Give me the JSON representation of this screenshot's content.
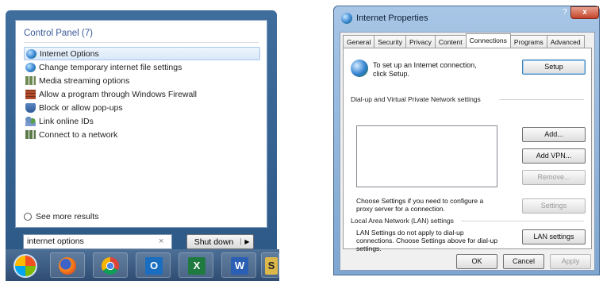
{
  "start_menu": {
    "heading": "Control Panel (7)",
    "items": [
      {
        "label": "Internet Options",
        "icon": "internet-options-icon",
        "selected": true
      },
      {
        "label": "Change temporary internet file settings",
        "icon": "internet-options-icon"
      },
      {
        "label": "Media streaming options",
        "icon": "network-icon"
      },
      {
        "label": "Allow a program through Windows Firewall",
        "icon": "firewall-icon"
      },
      {
        "label": "Block or allow pop-ups",
        "icon": "shield-icon"
      },
      {
        "label": "Link online IDs",
        "icon": "users-icon"
      },
      {
        "label": "Connect to a network",
        "icon": "network-icon"
      }
    ],
    "see_more": "See more results",
    "search_value": "internet options",
    "clear_glyph": "×",
    "shutdown_label": "Shut down",
    "shutdown_arrow": "▶"
  },
  "taskbar": {
    "items": [
      {
        "name": "start-orb-icon"
      },
      {
        "name": "firefox-icon"
      },
      {
        "name": "chrome-icon"
      },
      {
        "name": "outlook-icon",
        "glyph": "O"
      },
      {
        "name": "excel-icon",
        "glyph": "X"
      },
      {
        "name": "word-icon",
        "glyph": "W"
      },
      {
        "name": "sway-icon",
        "glyph": "S"
      }
    ]
  },
  "dialog": {
    "title": "Internet Properties",
    "help_glyph": "?",
    "close_glyph": "x",
    "tabs": [
      "General",
      "Security",
      "Privacy",
      "Content",
      "Connections",
      "Programs",
      "Advanced"
    ],
    "active_tab": "Connections",
    "setup_text": "To set up an Internet connection, click Setup.",
    "setup_button": "Setup",
    "dialup_group": "Dial-up and Virtual Private Network settings",
    "add_button": "Add...",
    "add_vpn_button": "Add VPN...",
    "remove_button": "Remove...",
    "settings_button": "Settings",
    "proxy_text": "Choose Settings if you need to configure a proxy server for a connection.",
    "lan_group": "Local Area Network (LAN) settings",
    "lan_text": "LAN Settings do not apply to dial-up connections. Choose Settings above for dial-up settings.",
    "lan_button": "LAN settings",
    "ok_button": "OK",
    "cancel_button": "Cancel",
    "apply_button": "Apply"
  }
}
